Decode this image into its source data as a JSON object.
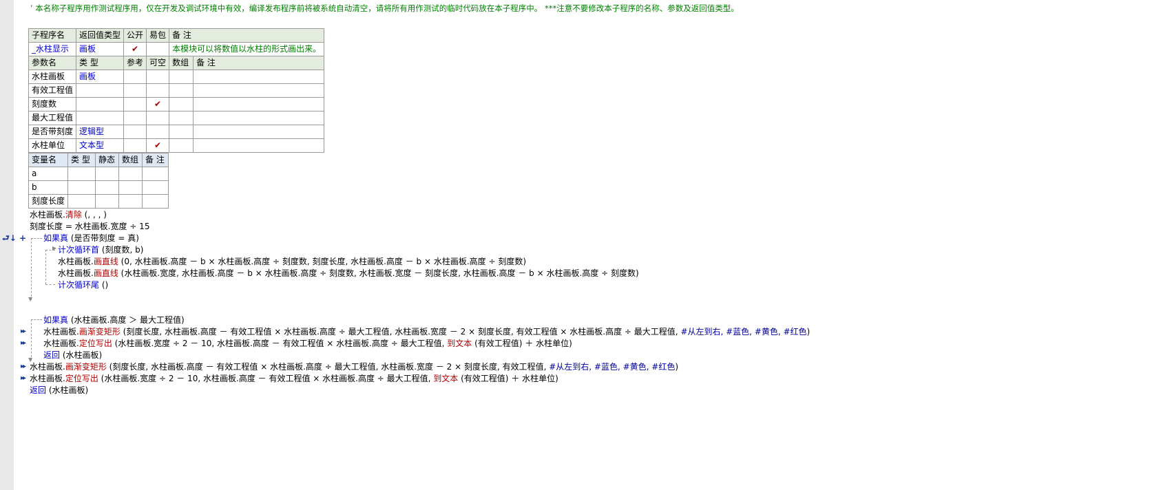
{
  "header_comment": "’ 本名称子程序用作测试程序用，仅在开发及调试环境中有效，编译发布程序前将被系统自动清空，请将所有用作测试的临时代码放在本子程序中。 ***注意不要修改本子程序的名称、参数及返回值类型。",
  "sub_table": {
    "headers": [
      "子程序名",
      "返回值类型",
      "公开",
      "易包",
      "备 注"
    ],
    "row": {
      "name": "_水柱显示",
      "return_type": "画板",
      "public": "✔",
      "easy": "",
      "note": "本模块可以将数值以水柱的形式画出来。"
    }
  },
  "param_table": {
    "headers": [
      "参数名",
      "类 型",
      "参考",
      "可空",
      "数组",
      "备 注"
    ],
    "rows": [
      {
        "name": "水柱画板",
        "type": "画板",
        "ref": "",
        "nullable": ""
      },
      {
        "name": "有效工程值",
        "type": "",
        "ref": "",
        "nullable": ""
      },
      {
        "name": "刻度数",
        "type": "",
        "ref": "",
        "nullable": "✔"
      },
      {
        "name": "最大工程值",
        "type": "",
        "ref": "",
        "nullable": ""
      },
      {
        "name": "是否带刻度",
        "type": "逻辑型",
        "ref": "",
        "nullable": ""
      },
      {
        "name": "水柱单位",
        "type": "文本型",
        "ref": "",
        "nullable": "✔"
      }
    ]
  },
  "var_table": {
    "headers": [
      "变量名",
      "类 型",
      "静态",
      "数组",
      "备 注"
    ],
    "rows": [
      {
        "name": "a"
      },
      {
        "name": "b"
      },
      {
        "name": "刻度长度"
      }
    ]
  },
  "code": {
    "l1": [
      "水柱画板.",
      "清除",
      " (, , , )"
    ],
    "l2": "刻度长度 = 水柱画板.宽度 ÷ 15",
    "l3": [
      "如果真",
      " (是否带刻度 = 真)"
    ],
    "l4": [
      "计次循环首",
      " (刻度数, b)"
    ],
    "l5": [
      "水柱画板.",
      "画直线",
      " (0, 水柱画板.高度 － b × 水柱画板.高度 ÷ 刻度数, 刻度长度, 水柱画板.高度 － b × 水柱画板.高度 ÷ 刻度数)"
    ],
    "l6": [
      "水柱画板.",
      "画直线",
      " (水柱画板.宽度, 水柱画板.高度 － b × 水柱画板.高度 ÷ 刻度数, 水柱画板.宽度 － 刻度长度, 水柱画板.高度 － b × 水柱画板.高度 ÷ 刻度数)"
    ],
    "l7": [
      "计次循环尾",
      " ()"
    ],
    "l8": [
      "如果真",
      " (水柱画板.高度 ＞ 最大工程值)"
    ],
    "l9": [
      "水柱画板.",
      "画渐变矩形",
      " (刻度长度, 水柱画板.高度 － 有效工程值 × 水柱画板.高度 ÷ 最大工程值, 水柱画板.宽度 － 2 × 刻度长度, 有效工程值 × 水柱画板.高度 ÷ 最大工程值, ",
      "#从左到右, #蓝色, #黄色, #红色",
      ")"
    ],
    "l10": [
      "水柱画板.",
      "定位写出",
      " (水柱画板.宽度 ÷ 2 － 10, 水柱画板.高度 － 有效工程值 × 水柱画板.高度 ÷ 最大工程值, ",
      "到文本",
      " (有效工程值) ＋ 水柱单位)"
    ],
    "l11": [
      "返回",
      " (水柱画板)"
    ],
    "l12": [
      "水柱画板.",
      "画渐变矩形",
      " (刻度长度, 水柱画板.高度 － 有效工程值 × 水柱画板.高度 ÷ 最大工程值, 水柱画板.宽度 － 2 × 刻度长度, 有效工程值, ",
      "#从左到右, #蓝色, #黄色, #红色",
      ")"
    ],
    "l13": [
      "水柱画板.",
      "定位写出",
      " (水柱画板.宽度 ÷ 2 － 10, 水柱画板.高度 － 有效工程值 × 水柱画板.高度 ÷ 最大工程值, ",
      "到文本",
      " (有效工程值) ＋ 水柱单位)"
    ],
    "l14": [
      "返回",
      " (水柱画板)"
    ]
  },
  "gutter": {
    "collapse_marker": "⮐↓ +",
    "breakpoint_marker": "▸▸"
  },
  "colors": {
    "keyword": "#0000cc",
    "function": "#b00000",
    "comment": "#008000",
    "check": "#a00000",
    "header_bg": "#e4ecdf"
  }
}
